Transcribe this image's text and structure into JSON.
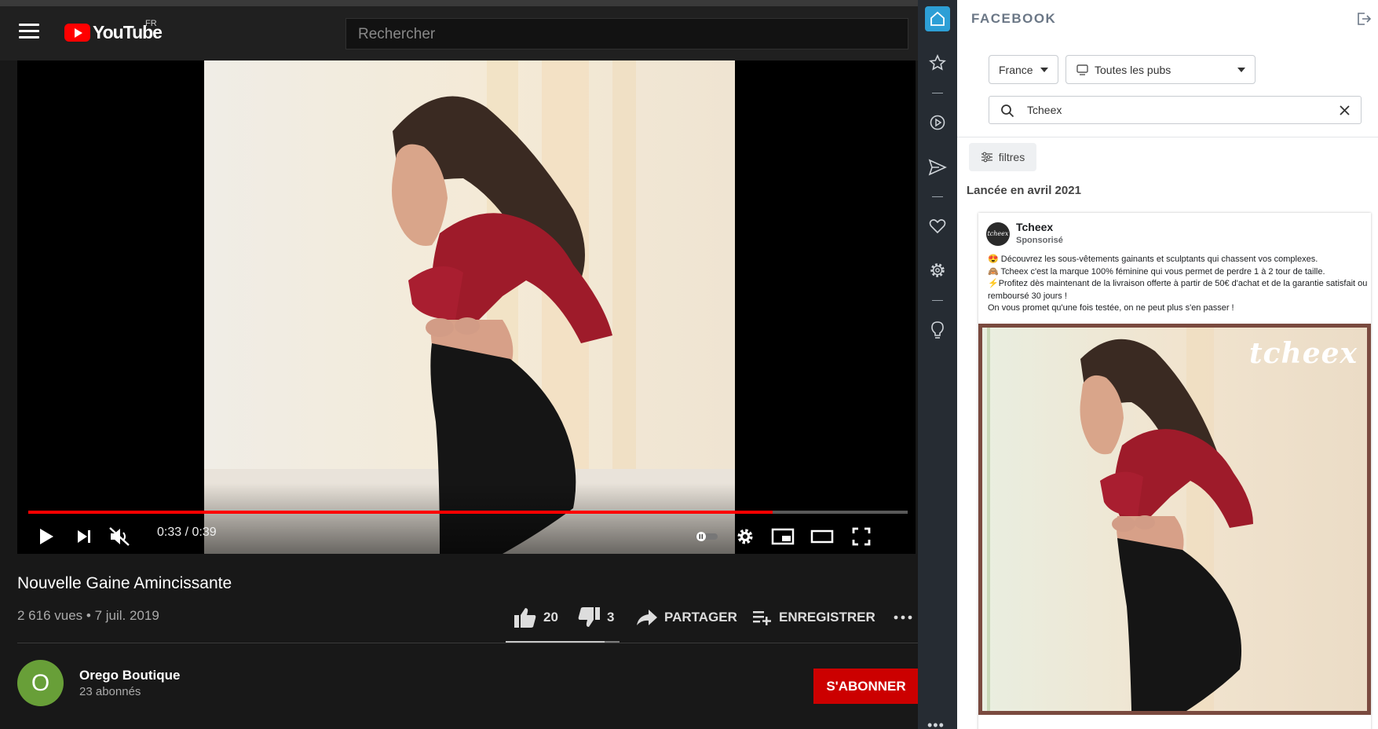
{
  "youtube": {
    "logo_text": "YouTube",
    "region": "FR",
    "search_placeholder": "Rechercher",
    "player": {
      "current_time": "0:33",
      "duration": "0:39",
      "time_display": "0:33 / 0:39",
      "progress_fraction": 0.846
    },
    "video": {
      "title": "Nouvelle Gaine Amincissante",
      "meta": "2 616 vues • 7 juil. 2019"
    },
    "actions": {
      "likes": "20",
      "dislikes": "3",
      "share_label": "PARTAGER",
      "save_label": "ENREGISTRER",
      "like_ratio": 0.87
    },
    "channel": {
      "avatar_letter": "O",
      "name": "Orego Boutique",
      "subscribers": "23 abonnés",
      "subscribe_label": "S'ABONNER"
    },
    "colors": {
      "accent": "#ff0000",
      "subscribe": "#cc0000",
      "background": "#181818"
    }
  },
  "extension_rail": {
    "items": [
      "home-icon",
      "star-icon",
      "play-circle-icon",
      "send-icon",
      "heart-icon",
      "gear-icon",
      "lightbulb-icon"
    ],
    "more": "•••",
    "accent": "#2d9fd6"
  },
  "facebook_panel": {
    "header": "FACEBOOK",
    "country": "France",
    "ad_type": "Toutes les pubs",
    "search_value": "Tcheex",
    "filters_label": "filtres",
    "launched": "Lancée en avril 2021",
    "ad": {
      "advertiser": "Tcheex",
      "sponsored": "Sponsorisé",
      "avatar_text": "tcheex",
      "text_lines": [
        "😍 Découvrez les sous-vêtements gainants et sculptants qui chassent vos complexes.",
        "🙈 Tcheex c'est la marque 100% féminine qui vous permet de perdre 1 à 2 tour de taille.",
        "⚡Profitez dès maintenant de la livraison offerte à partir de 50€ d'achat et de la garantie satisfait ou remboursé 30 jours !",
        "On vous promet qu'une fois testée, on ne peut plus s'en passer !"
      ],
      "image_watermark": "tcheex"
    }
  }
}
